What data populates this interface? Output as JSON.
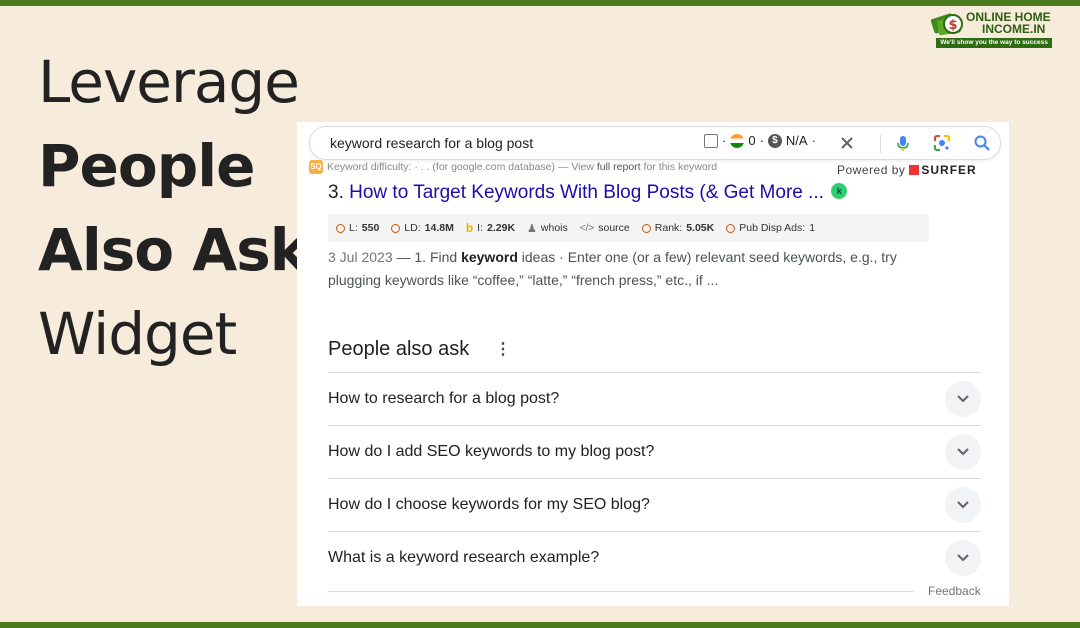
{
  "headline": {
    "line1": "Leverage",
    "line2": "People",
    "line3": "Also Ask",
    "line4": "Widget"
  },
  "logo": {
    "line1": "ONLINE HOME",
    "line2": "INCOME.IN",
    "tagline": "We'll show you the way to success",
    "icon": "dollar-bill-icon"
  },
  "search": {
    "query": "keyword research for a blog post",
    "meta_sep1": "·",
    "meta_zero": "0",
    "meta_sep2": "·",
    "meta_na": "N/A",
    "meta_sep3": "·",
    "icons": [
      "checkbox-icon",
      "india-flag-icon",
      "dollar-icon",
      "close-icon",
      "mic-icon",
      "lens-icon",
      "search-icon"
    ]
  },
  "keyword_bar": {
    "text_prefix": "Keyword difficulty: · . . (for google.com database) — View ",
    "link": "full report",
    "text_suffix": " for this keyword",
    "powered_label": "Powered by",
    "brand": "SURFER"
  },
  "result": {
    "number": "3.",
    "title": "How to Target Keywords With Blog Posts (& Get More ...",
    "badge": "k",
    "metrics": [
      {
        "label": "L: ",
        "value": "550"
      },
      {
        "label": "LD: ",
        "value": "14.8M"
      },
      {
        "label": "I: ",
        "value": "2.29K"
      },
      {
        "label": "whois",
        "value": ""
      },
      {
        "label": "source",
        "value": ""
      },
      {
        "label": "Rank: ",
        "value": "5.05K"
      },
      {
        "label": "Pub Disp Ads: ",
        "value": "1"
      }
    ],
    "snippet_date": "3 Jul 2023",
    "snippet_a": " — 1. Find ",
    "snippet_bold": "keyword",
    "snippet_b": " ideas · Enter one (or a few) relevant seed keywords, e.g., try plugging keywords like “coffee,” “latte,” “french press,” etc., if ..."
  },
  "paa": {
    "heading": "People also ask",
    "questions": [
      "How to research for a blog post?",
      "How do I add SEO keywords to my blog post?",
      "How do I choose keywords for my SEO blog?",
      "What is a keyword research example?"
    ],
    "feedback": "Feedback"
  },
  "colors": {
    "background": "#f7ecdc",
    "frame_green": "#4a7a1c",
    "link_blue": "#1a0dab"
  }
}
